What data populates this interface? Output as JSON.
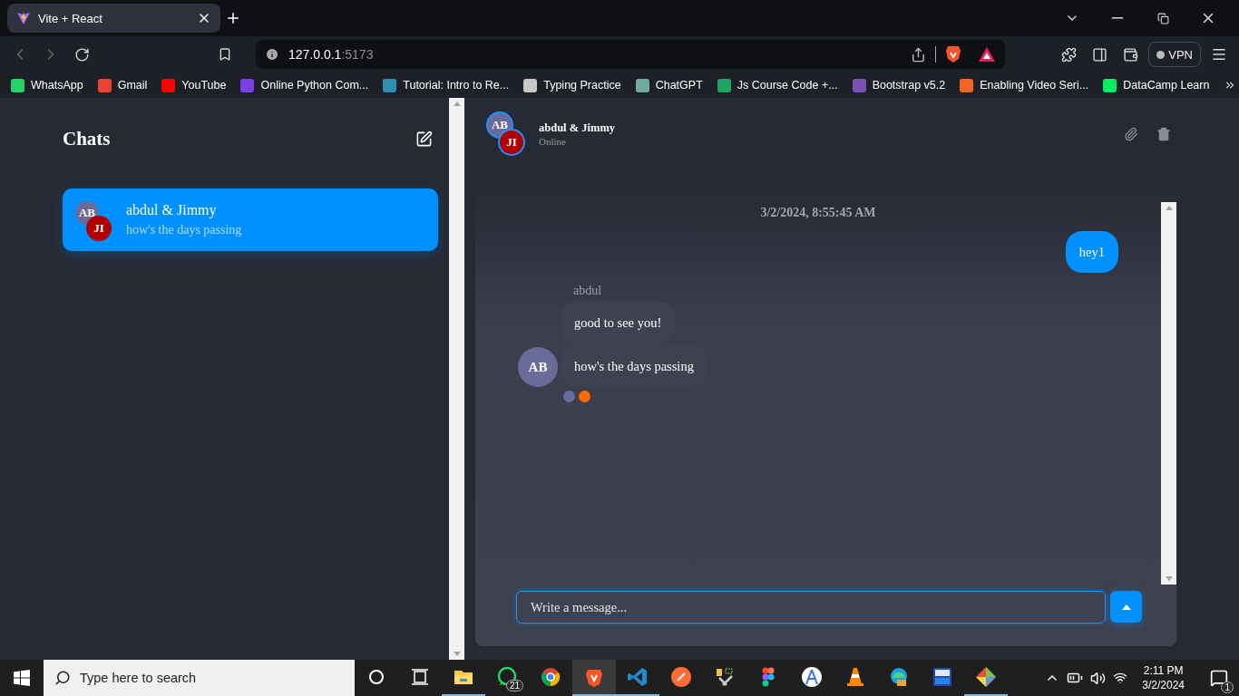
{
  "browser": {
    "tab": {
      "title": "Vite + React",
      "selected": true
    },
    "address": {
      "host": "127.0.0.1",
      "port": ":5173"
    },
    "vpn_label": "VPN",
    "bookmarks": [
      {
        "label": "WhatsApp",
        "color": "#25d366"
      },
      {
        "label": "Gmail",
        "color": "#ea4335"
      },
      {
        "label": "YouTube",
        "color": "#ff0000"
      },
      {
        "label": "Online Python Com...",
        "color": "#7b3fe4"
      },
      {
        "label": "Tutorial: Intro to Re...",
        "color": "#2f8fb0"
      },
      {
        "label": "Typing Practice",
        "color": "#c8c8c8"
      },
      {
        "label": "ChatGPT",
        "color": "#74aa9c"
      },
      {
        "label": "Js Course Code +...",
        "color": "#1fa463"
      },
      {
        "label": "Bootstrap v5.2",
        "color": "#7952b3"
      },
      {
        "label": "Enabling Video Seri...",
        "color": "#f26522"
      },
      {
        "label": "DataCamp Learn",
        "color": "#03ef62"
      }
    ]
  },
  "sidebar": {
    "title": "Chats",
    "chats": [
      {
        "name": "abdul & Jimmy",
        "preview": "how's the days passing",
        "avatars": [
          "AB",
          "JI"
        ],
        "selected": true
      }
    ]
  },
  "chat": {
    "name": "abdul & Jimmy",
    "status": "Online",
    "avatars": [
      "AB",
      "JI"
    ],
    "timestamp": "3/2/2024, 8:55:45 AM",
    "messages": [
      {
        "kind": "outgoing",
        "texts": [
          "hey1"
        ]
      },
      {
        "kind": "incoming",
        "sender": "abdul",
        "avatar": "AB",
        "texts": [
          "good to see you!",
          "how's the days passing"
        ],
        "read_by": [
          {
            "color": "#6b6b9a"
          },
          {
            "color": "#ff6a00"
          }
        ]
      }
    ],
    "input": {
      "placeholder": "Write a message..."
    }
  },
  "taskbar": {
    "search_placeholder": "Type here to search",
    "apps": [
      {
        "kind": "folder",
        "open": true,
        "selected": false
      },
      {
        "kind": "whatsapp",
        "open": false,
        "selected": false,
        "badge": "21"
      },
      {
        "kind": "chrome",
        "open": false,
        "selected": false
      },
      {
        "kind": "brave",
        "open": true,
        "selected": true
      },
      {
        "kind": "vscode",
        "open": true,
        "selected": false
      },
      {
        "kind": "postman",
        "open": false,
        "selected": false
      },
      {
        "kind": "tools",
        "open": false,
        "selected": false
      },
      {
        "kind": "figma",
        "open": false,
        "selected": false
      },
      {
        "kind": "android",
        "open": false,
        "selected": false
      },
      {
        "kind": "vlc",
        "open": false,
        "selected": false
      },
      {
        "kind": "edge",
        "open": false,
        "selected": false
      },
      {
        "kind": "devcpp",
        "open": false,
        "selected": false
      },
      {
        "kind": "git",
        "open": true,
        "selected": false
      }
    ],
    "time": "2:11 PM",
    "date": "3/2/2024",
    "notification_count": "1"
  }
}
